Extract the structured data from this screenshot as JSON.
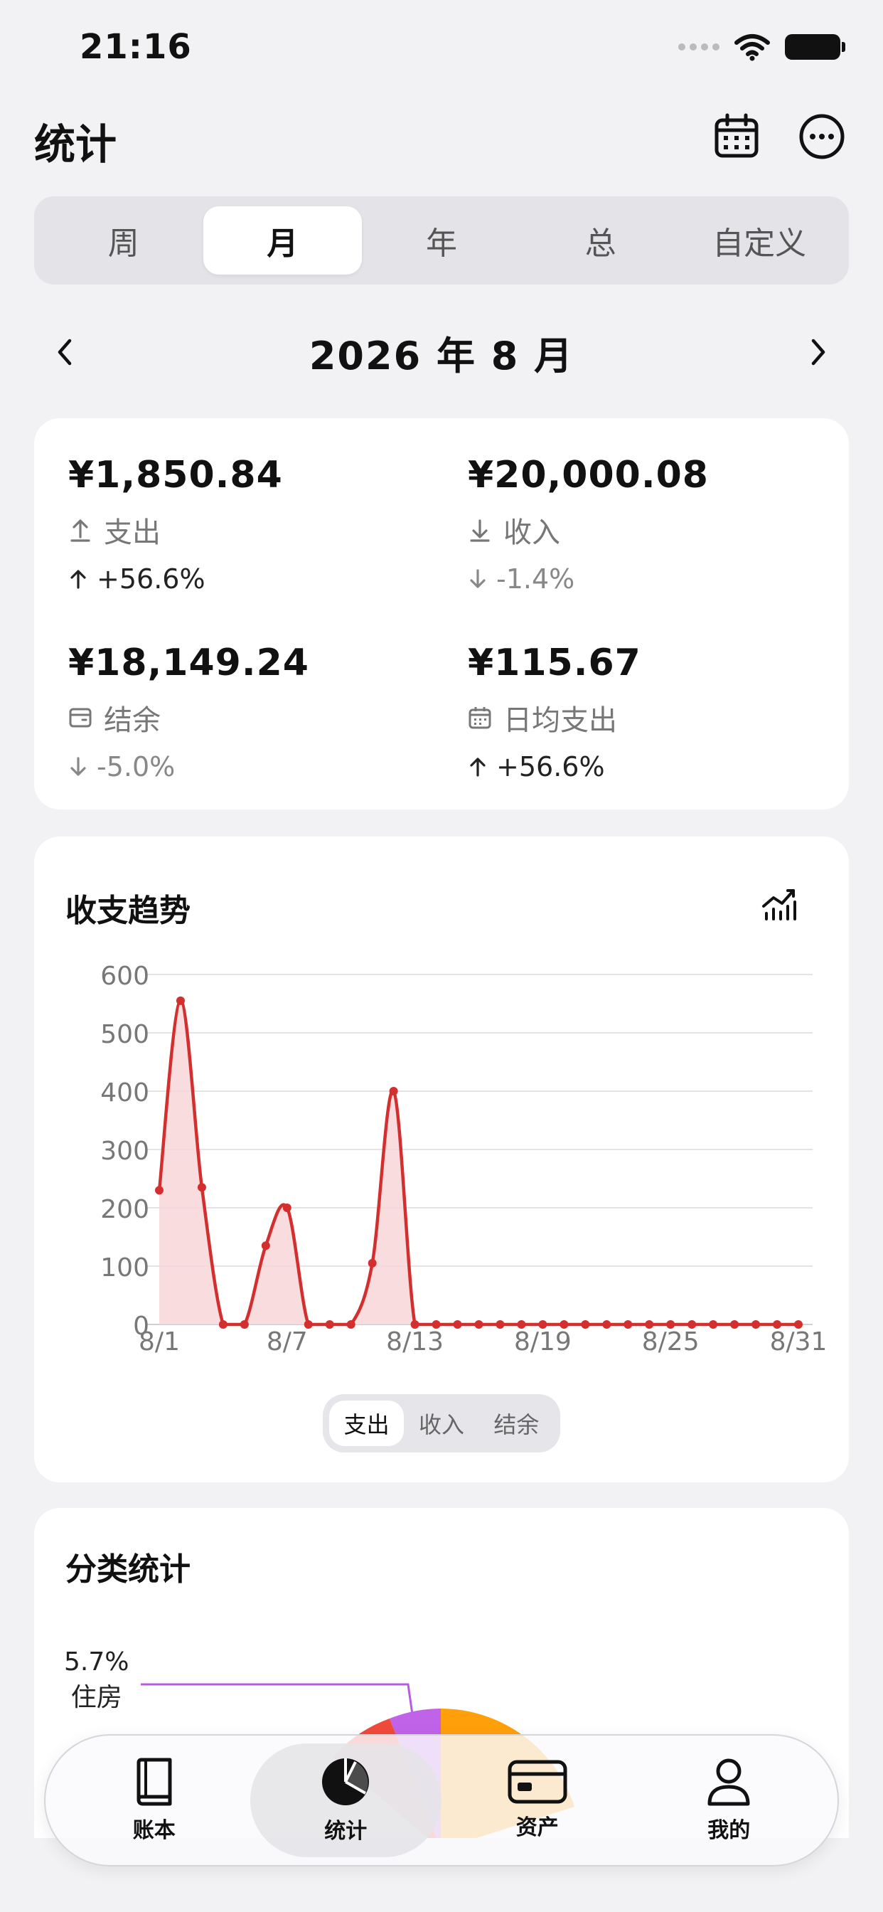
{
  "status_bar": {
    "time": "21:16"
  },
  "header": {
    "title": "统计",
    "calendar_icon": "calendar-icon",
    "more_icon": "more-icon"
  },
  "period_tabs": [
    {
      "label": "周",
      "active": false
    },
    {
      "label": "月",
      "active": true
    },
    {
      "label": "年",
      "active": false
    },
    {
      "label": "总",
      "active": false
    },
    {
      "label": "自定义",
      "active": false
    }
  ],
  "period": {
    "title": "2026 年 8 月"
  },
  "summary": {
    "expense": {
      "amount": "¥1,850.84",
      "label": "支出",
      "change": "+56.6%",
      "direction": "up"
    },
    "income": {
      "amount": "¥20,000.08",
      "label": "收入",
      "change": "-1.4%",
      "direction": "down"
    },
    "balance": {
      "amount": "¥18,149.24",
      "label": "结余",
      "change": "-5.0%",
      "direction": "down"
    },
    "daily_avg": {
      "amount": "¥115.67",
      "label": "日均支出",
      "change": "+56.6%",
      "direction": "up"
    }
  },
  "trend": {
    "title": "收支趋势",
    "series_toggle": [
      {
        "label": "支出",
        "active": true
      },
      {
        "label": "收入",
        "active": false
      },
      {
        "label": "结余",
        "active": false
      }
    ]
  },
  "chart_data": {
    "type": "area",
    "title": "收支趋势",
    "x_tick_labels": [
      "8/1",
      "8/7",
      "8/13",
      "8/19",
      "8/25",
      "8/31"
    ],
    "y_tick_labels": [
      "0",
      "100",
      "200",
      "300",
      "400",
      "500",
      "600"
    ],
    "ylim": [
      0,
      600
    ],
    "xlim": [
      1,
      31
    ],
    "grid": true,
    "color": "#d32f2f",
    "fill_color": "#f7d6d8",
    "series": [
      {
        "values": [
          230,
          555,
          235,
          0,
          0,
          135,
          200,
          0,
          0,
          0,
          105,
          400,
          0,
          0,
          0,
          0,
          0,
          0,
          0,
          0,
          0,
          0,
          0,
          0,
          0,
          0,
          0,
          0,
          0,
          0,
          0
        ]
      }
    ]
  },
  "category": {
    "title": "分类统计",
    "visible_labels": [
      {
        "percent": "5.7%",
        "name": "住房",
        "color": "#b95be0"
      }
    ]
  },
  "tabbar": [
    {
      "label": "账本",
      "icon": "book-icon",
      "active": false
    },
    {
      "label": "统计",
      "icon": "pie-chart-icon",
      "active": true
    },
    {
      "label": "资产",
      "icon": "card-icon",
      "active": false
    },
    {
      "label": "我的",
      "icon": "person-icon",
      "active": false
    }
  ]
}
